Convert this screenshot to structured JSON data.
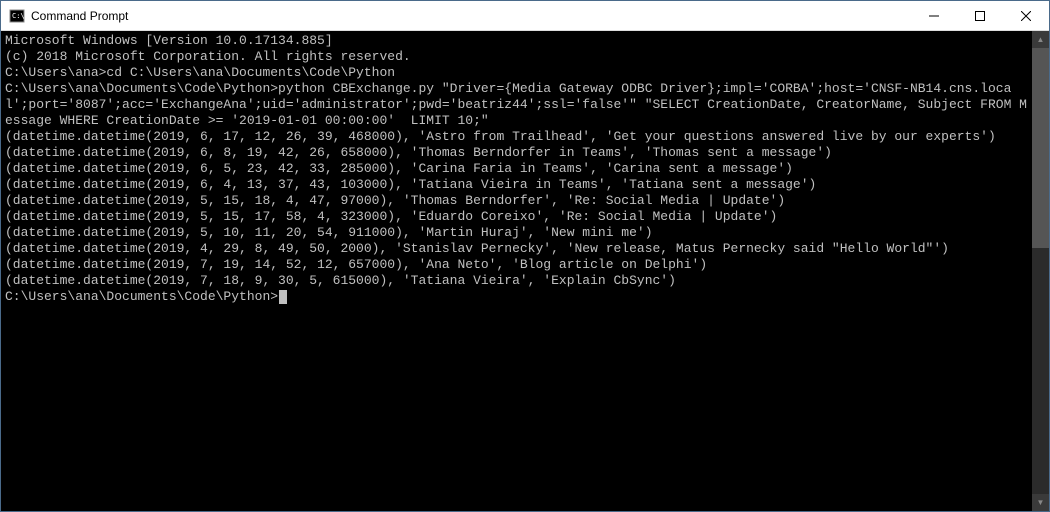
{
  "window": {
    "title": "Command Prompt"
  },
  "terminal": {
    "header1": "Microsoft Windows [Version 10.0.17134.885]",
    "header2": "(c) 2018 Microsoft Corporation. All rights reserved.",
    "prompt1": "C:\\Users\\ana>",
    "cmd1": "cd C:\\Users\\ana\\Documents\\Code\\Python",
    "prompt2": "C:\\Users\\ana\\Documents\\Code\\Python>",
    "cmd2": "python CBExchange.py \"Driver={Media Gateway ODBC Driver};impl='CORBA';host='CNSF-NB14.cns.local';port='8087';acc='ExchangeAna';uid='administrator';pwd='beatriz44';ssl='false'\" \"SELECT CreationDate, CreatorName, Subject FROM Message WHERE CreationDate >= '2019-01-01 00:00:00'  LIMIT 10;\"",
    "rows": [
      "(datetime.datetime(2019, 6, 17, 12, 26, 39, 468000), 'Astro from Trailhead', 'Get your questions answered live by our experts')",
      "(datetime.datetime(2019, 6, 8, 19, 42, 26, 658000), 'Thomas Berndorfer in Teams', 'Thomas sent a message')",
      "(datetime.datetime(2019, 6, 5, 23, 42, 33, 285000), 'Carina Faria in Teams', 'Carina sent a message')",
      "(datetime.datetime(2019, 6, 4, 13, 37, 43, 103000), 'Tatiana Vieira in Teams', 'Tatiana sent a message')",
      "(datetime.datetime(2019, 5, 15, 18, 4, 47, 97000), 'Thomas Berndorfer', 'Re: Social Media | Update')",
      "(datetime.datetime(2019, 5, 15, 17, 58, 4, 323000), 'Eduardo Coreixo', 'Re: Social Media | Update')",
      "(datetime.datetime(2019, 5, 10, 11, 20, 54, 911000), 'Martin Huraj', 'New mini me')",
      "(datetime.datetime(2019, 4, 29, 8, 49, 50, 2000), 'Stanislav Pernecky', 'New release, Matus Pernecky said \"Hello World\"')",
      "(datetime.datetime(2019, 7, 19, 14, 52, 12, 657000), 'Ana Neto', 'Blog article on Delphi')",
      "(datetime.datetime(2019, 7, 18, 9, 30, 5, 615000), 'Tatiana Vieira', 'Explain CbSync')"
    ],
    "prompt3": "C:\\Users\\ana\\Documents\\Code\\Python>"
  }
}
